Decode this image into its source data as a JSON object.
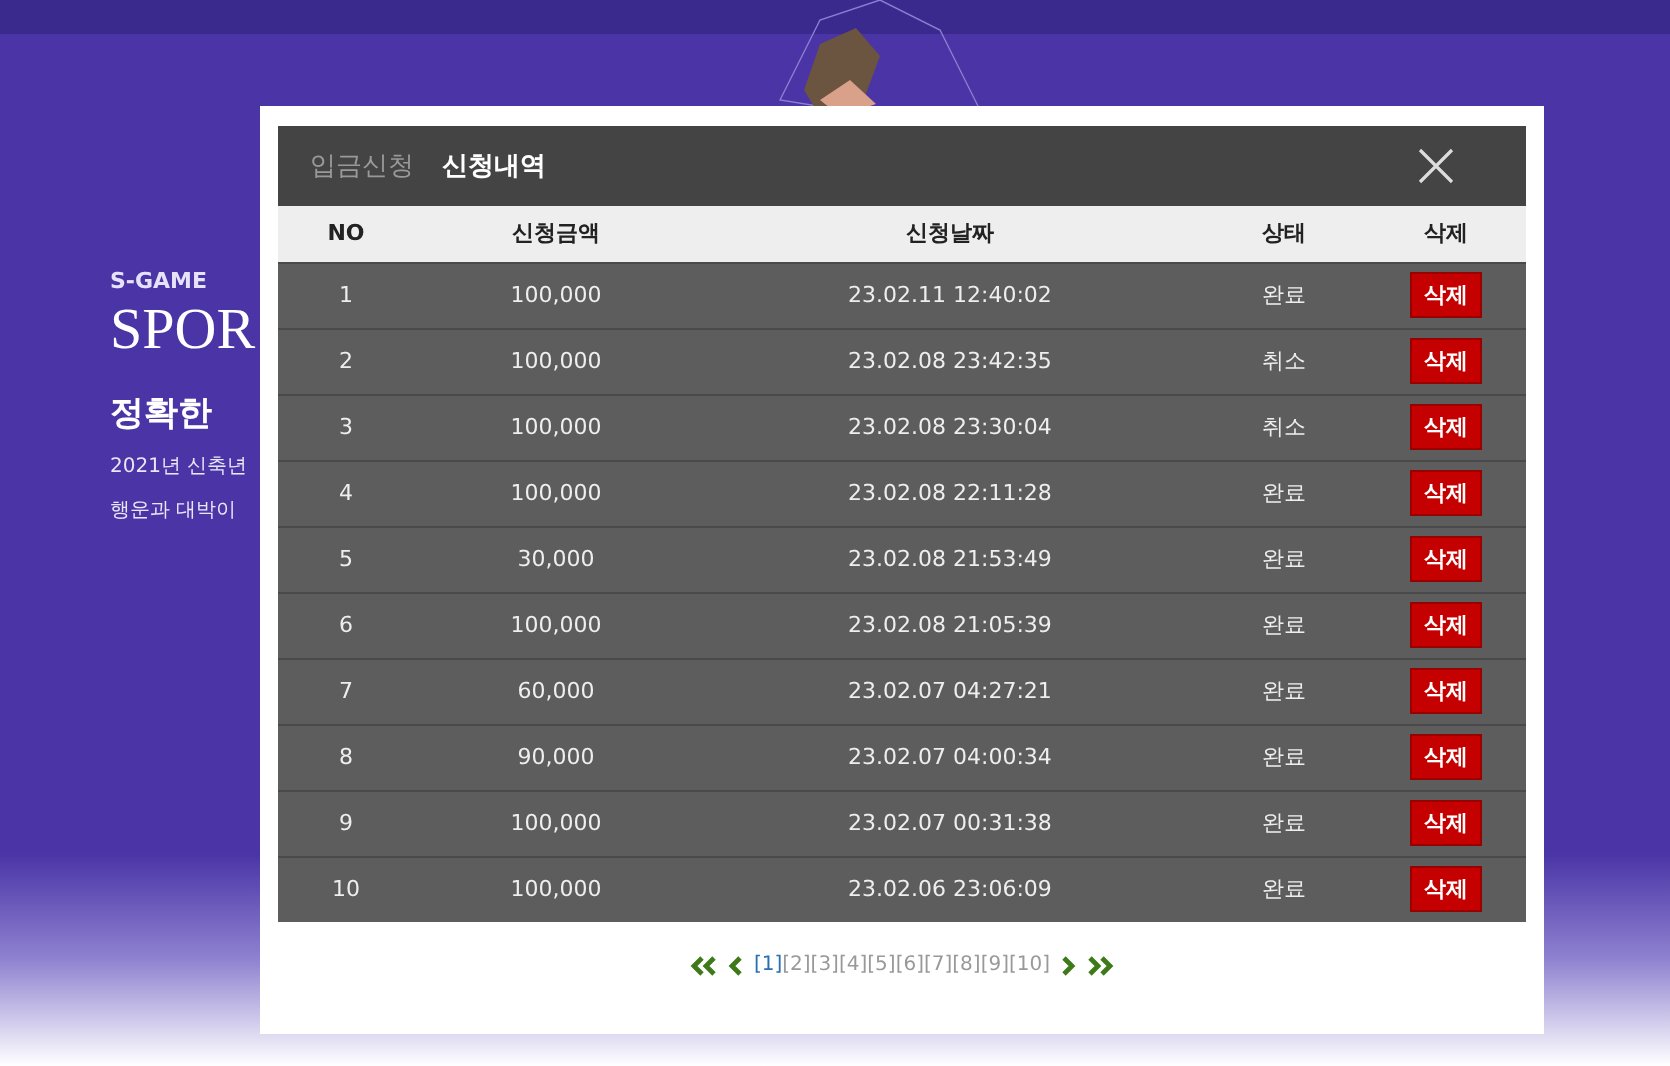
{
  "hero": {
    "brand": "S-GAME",
    "title": "SPOR",
    "headline": "정확한",
    "lines": [
      "2021년 신축년",
      "행운과 대박이"
    ]
  },
  "modal": {
    "tabs": [
      {
        "label": "입금신청",
        "selected": false
      },
      {
        "label": "신청내역",
        "selected": true
      }
    ],
    "table": {
      "columns": [
        "NO",
        "신청금액",
        "신청날짜",
        "상태",
        "삭제"
      ],
      "rows": [
        {
          "no": "1",
          "amount": "100,000",
          "date": "23.02.11 12:40:02",
          "status": "완료",
          "action": "삭제"
        },
        {
          "no": "2",
          "amount": "100,000",
          "date": "23.02.08 23:42:35",
          "status": "취소",
          "action": "삭제"
        },
        {
          "no": "3",
          "amount": "100,000",
          "date": "23.02.08 23:30:04",
          "status": "취소",
          "action": "삭제"
        },
        {
          "no": "4",
          "amount": "100,000",
          "date": "23.02.08 22:11:28",
          "status": "완료",
          "action": "삭제"
        },
        {
          "no": "5",
          "amount": "30,000",
          "date": "23.02.08 21:53:49",
          "status": "완료",
          "action": "삭제"
        },
        {
          "no": "6",
          "amount": "100,000",
          "date": "23.02.08 21:05:39",
          "status": "완료",
          "action": "삭제"
        },
        {
          "no": "7",
          "amount": "60,000",
          "date": "23.02.07 04:27:21",
          "status": "완료",
          "action": "삭제"
        },
        {
          "no": "8",
          "amount": "90,000",
          "date": "23.02.07 04:00:34",
          "status": "완료",
          "action": "삭제"
        },
        {
          "no": "9",
          "amount": "100,000",
          "date": "23.02.07 00:31:38",
          "status": "완료",
          "action": "삭제"
        },
        {
          "no": "10",
          "amount": "100,000",
          "date": "23.02.06 23:06:09",
          "status": "완료",
          "action": "삭제"
        }
      ]
    },
    "pagination": [
      {
        "label": "[1]",
        "selected": true
      },
      {
        "label": "[2]",
        "selected": false
      },
      {
        "label": "[3]",
        "selected": false
      },
      {
        "label": "[4]",
        "selected": false
      },
      {
        "label": "[5]",
        "selected": false
      },
      {
        "label": "[6]",
        "selected": false
      },
      {
        "label": "[7]",
        "selected": false
      },
      {
        "label": "[8]",
        "selected": false
      },
      {
        "label": "[9]",
        "selected": false
      },
      {
        "label": "[10]",
        "selected": false
      }
    ]
  }
}
